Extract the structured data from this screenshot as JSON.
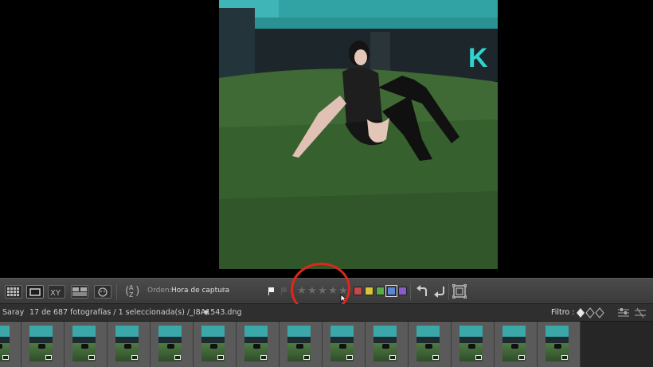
{
  "toolbar": {
    "view_modes": [
      "grid-view-icon",
      "loupe-view-icon",
      "compare-view-icon",
      "survey-view-icon",
      "people-view-icon"
    ],
    "sort_label": "Orden:",
    "sort_value": "Hora de captura",
    "rating_stars": 0,
    "color_labels": [
      {
        "name": "red",
        "color": "#c4474a"
      },
      {
        "name": "yellow",
        "color": "#d9c53a"
      },
      {
        "name": "green",
        "color": "#5aaa47"
      },
      {
        "name": "blue",
        "color": "#5b86d6",
        "selected": true
      },
      {
        "name": "purple",
        "color": "#8a5cc7"
      }
    ],
    "sort_icon_text": "A\nZ"
  },
  "infobar": {
    "source": "Saray",
    "status": "17 de 687 fotografías / 1 seleccionada(s) /_I8A1543.dng",
    "filter_label": "Filtro :"
  },
  "photo": {
    "sign_letter": "K"
  },
  "filmstrip": {
    "thumbnail_count": 13
  },
  "colors": {
    "accent_annotation": "#e0261a",
    "panel_bg": "#3a3a3a"
  }
}
